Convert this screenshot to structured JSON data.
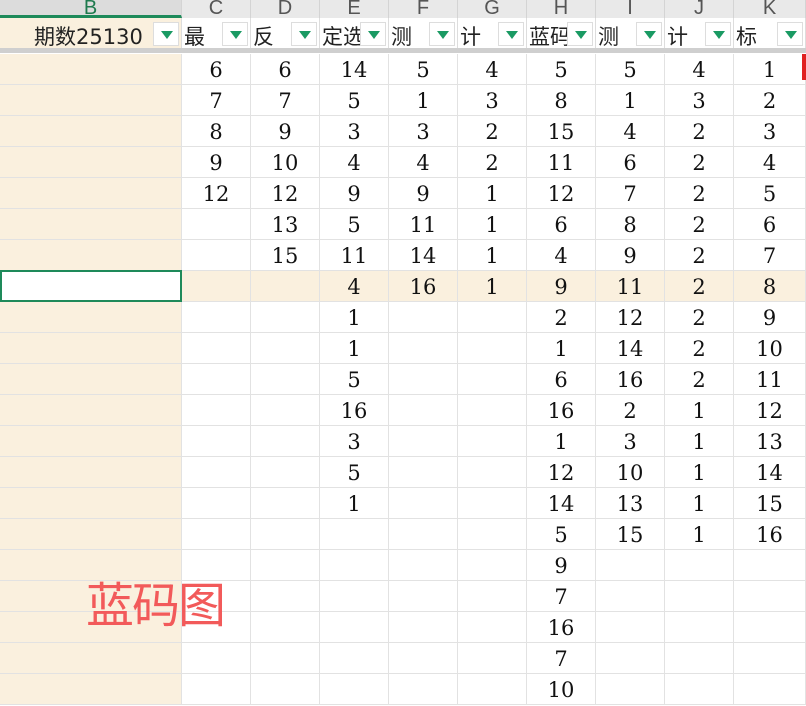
{
  "columns": [
    "B",
    "C",
    "D",
    "E",
    "F",
    "G",
    "H",
    "I",
    "J",
    "K"
  ],
  "headers": [
    "期数25130",
    "最",
    "反",
    "定选",
    "测",
    "计",
    "蓝码",
    "测",
    "计",
    "标"
  ],
  "data": {
    "C": [
      6,
      7,
      8,
      9,
      12
    ],
    "D": [
      6,
      7,
      9,
      10,
      12,
      13,
      15
    ],
    "E": [
      14,
      5,
      3,
      4,
      9,
      5,
      11,
      4,
      1,
      1,
      5,
      16,
      3,
      5,
      1
    ],
    "F": [
      5,
      1,
      3,
      4,
      9,
      11,
      14,
      16
    ],
    "G": [
      4,
      3,
      2,
      2,
      1,
      1,
      1,
      1
    ],
    "H": [
      5,
      8,
      15,
      11,
      12,
      6,
      4,
      9,
      2,
      1,
      6,
      16,
      1,
      12,
      14,
      5,
      9,
      7,
      16,
      7,
      10
    ],
    "I": [
      5,
      1,
      4,
      6,
      7,
      8,
      9,
      11,
      12,
      14,
      16,
      2,
      3,
      10,
      13,
      15
    ],
    "J": [
      4,
      3,
      2,
      2,
      2,
      2,
      2,
      2,
      2,
      2,
      2,
      1,
      1,
      1,
      1,
      1
    ],
    "K": [
      1,
      2,
      3,
      4,
      5,
      6,
      7,
      8,
      9,
      10,
      11,
      12,
      13,
      14,
      15,
      16
    ]
  },
  "overlay_text": "蓝码图",
  "colors": {
    "accent": "#1e8a5a",
    "overlay": "#f25a5a",
    "highlight": "#faf0de"
  }
}
